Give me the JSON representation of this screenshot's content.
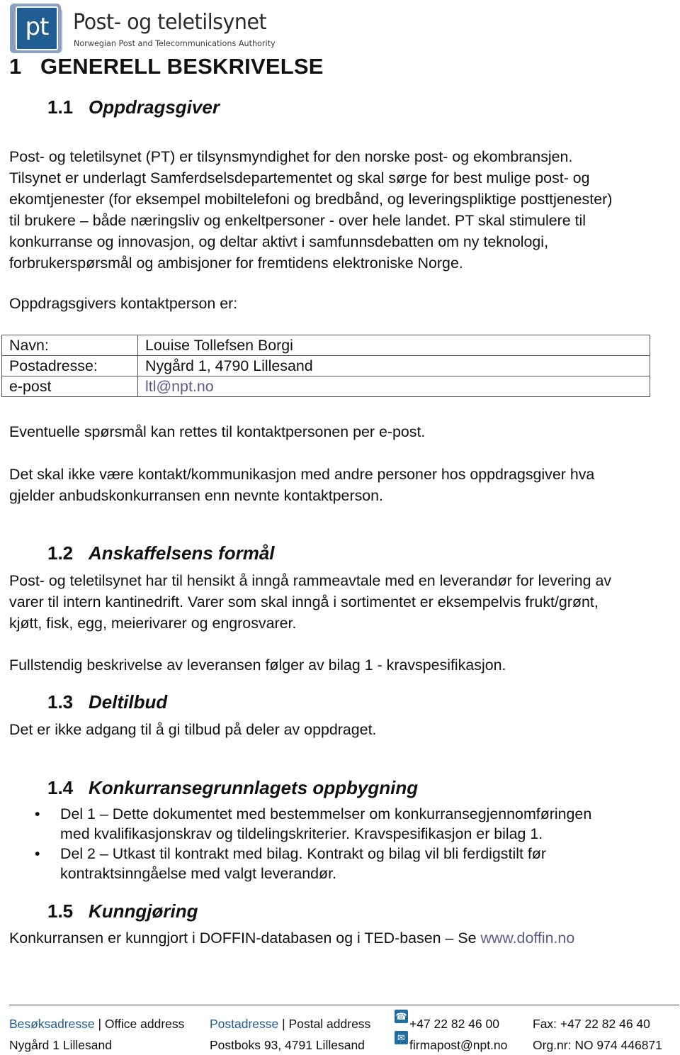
{
  "logo": {
    "mark": "pt",
    "title": "Post- og teletilsynet",
    "subtitle": "Norwegian Post and Telecommunications Authority"
  },
  "section1": {
    "number": "1",
    "title": "GENERELL BESKRIVELSE"
  },
  "s1_1": {
    "number": "1.1",
    "title": "Oppdragsgiver",
    "paragraph_lines": [
      "Post- og teletilsynet (PT) er tilsynsmyndighet for den norske post- og ekombransjen.",
      "Tilsynet er underlagt Samferdselsdepartementet og skal sørge for best mulige post- og",
      "ekomtjenester (for eksempel mobiltelefoni og bredbånd, og leveringspliktige posttjenester)",
      "til brukere – både næringsliv og enkeltpersoner - over hele landet. PT skal stimulere til",
      "konkurranse og innovasjon, og deltar aktivt i samfunnsdebatten om ny teknologi,",
      "forbrukerspørsmål og ambisjoner for fremtidens elektroniske Norge."
    ],
    "contact_intro": "Oppdragsgivers kontaktperson er:",
    "contact_table": [
      {
        "label": "Navn:",
        "value": "Louise Tollefsen Borgi"
      },
      {
        "label": "Postadresse:",
        "value": "Nygård 1, 4790 Lillesand"
      },
      {
        "label": "e-post",
        "value": "ltl@npt.no"
      }
    ],
    "questions": "Eventuelle spørsmål kan rettes til kontaktpersonen per e-post.",
    "no_contact_lines": [
      "Det skal ikke være kontakt/kommunikasjon med andre personer hos oppdragsgiver hva",
      "gjelder anbudskonkurransen enn nevnte kontaktperson."
    ]
  },
  "s1_2": {
    "number": "1.2",
    "title": "Anskaffelsens formål",
    "paragraph_lines": [
      "Post- og teletilsynet har til hensikt å inngå rammeavtale med en leverandør for levering av",
      "varer til intern kantinedrift. Varer som skal inngå i sortimentet er eksempelvis frukt/grønt,",
      "kjøtt, fisk, egg, meierivarer og engrosvarer."
    ],
    "full_description": "Fullstendig beskrivelse av leveransen følger av bilag 1 - kravspesifikasjon."
  },
  "s1_3": {
    "number": "1.3",
    "title": "Deltilbud",
    "text": "Det er ikke adgang til å gi tilbud på deler av oppdraget."
  },
  "s1_4": {
    "number": "1.4",
    "title": "Konkurransegrunnlagets oppbygning",
    "bullet_glyph": "•",
    "bullets": [
      {
        "line1": "Del 1 – Dette dokumentet med bestemmelser om konkurransegjennomføringen",
        "line2": "med kvalifikasjonskrav og tildelingskriterier. Kravspesifikasjon er bilag 1."
      },
      {
        "line1": "Del 2 – Utkast til kontrakt med bilag. Kontrakt og bilag vil bli ferdigstilt før",
        "line2": "kontraktsinngåelse med valgt leverandør."
      }
    ]
  },
  "s1_5": {
    "number": "1.5",
    "title": "Kunngjøring",
    "text": "Konkurransen er kunngjort i DOFFIN-databasen og i TED-basen – Se ",
    "link": "www.doffin.no"
  },
  "footer": {
    "office_label_no": "Besøksadresse",
    "office_label_en": " | Office address",
    "office_value": "Nygård 1 Lillesand",
    "postal_label_no": "Postadresse",
    "postal_label_en": " | Postal address",
    "postal_value": "Postboks 93, 4791 Lillesand",
    "phone_icon": "☎",
    "phone": "+47 22 82 46 00",
    "email_icon": "✉",
    "email": "firmapost@npt.no",
    "fax": "Fax: +47 22 82 46 40",
    "orgnr": "Org.nr: NO 974 446871"
  }
}
